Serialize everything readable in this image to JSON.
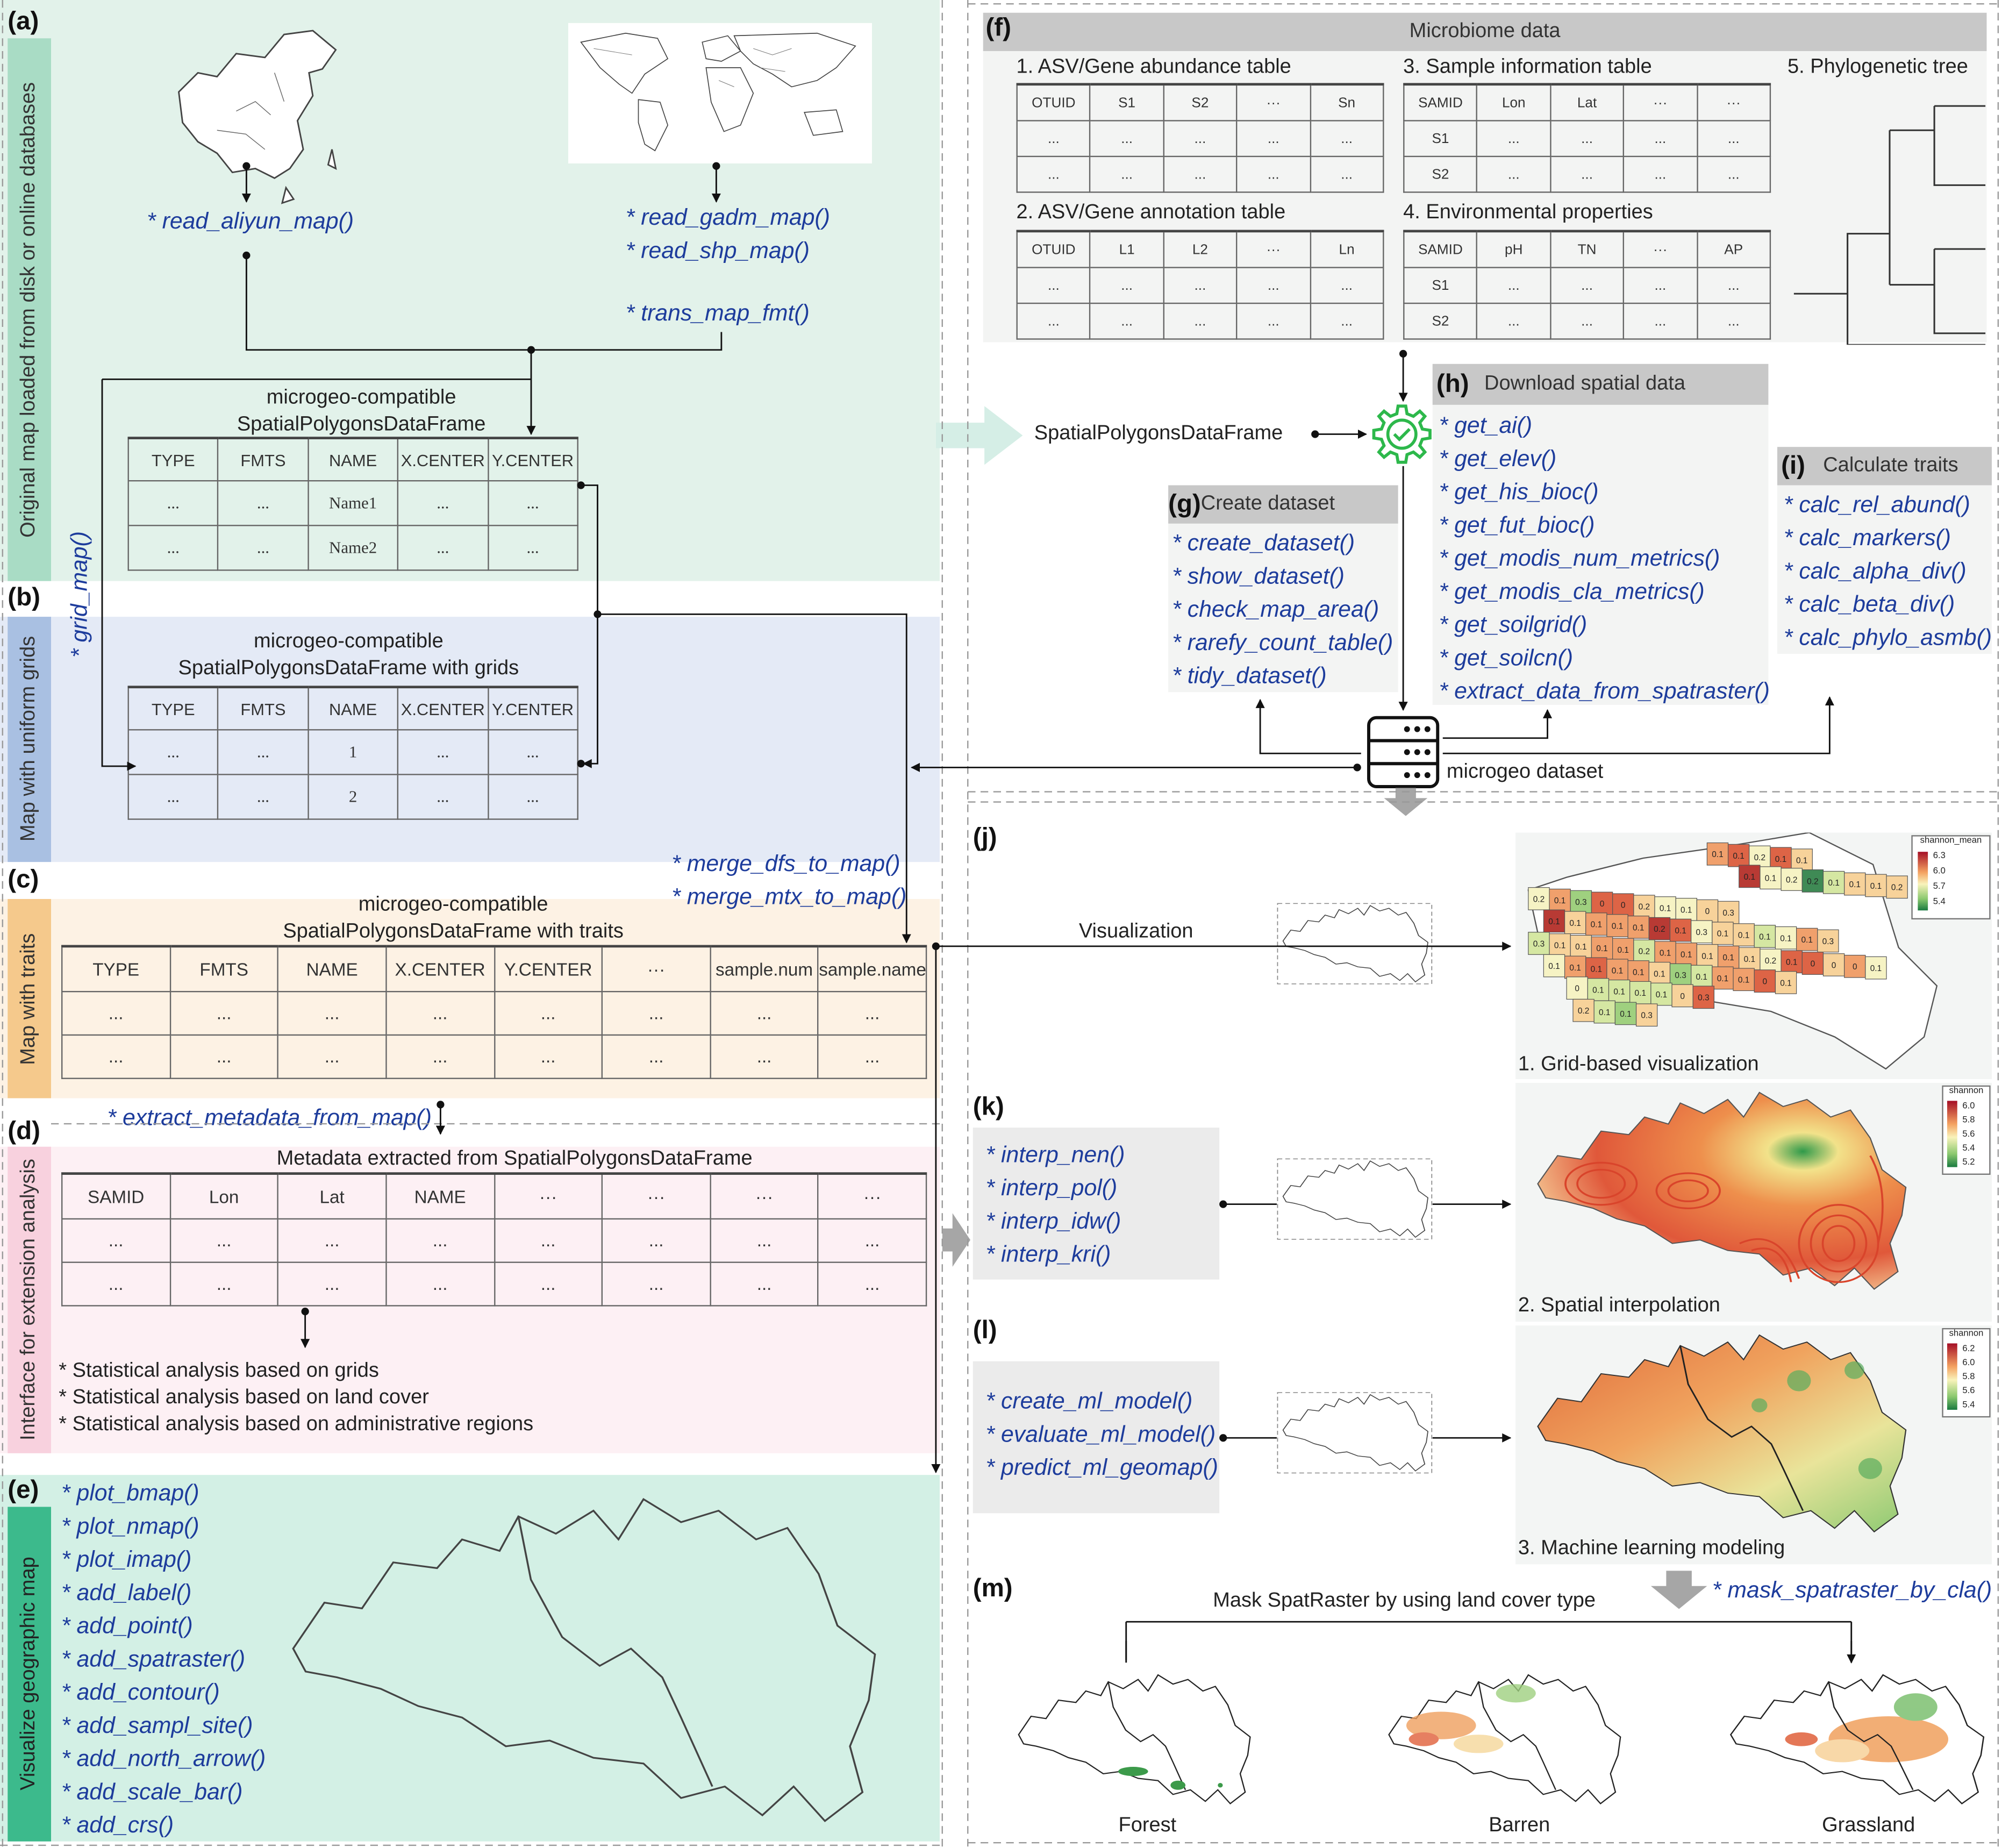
{
  "panels": {
    "a": {
      "label": "(a)",
      "strip": "Original map loaded from disk or online databases",
      "aliyun": "* read_aliyun_map()",
      "gadm_fns": [
        "* read_gadm_map()",
        "* read_shp_map()"
      ],
      "trans": "* trans_map_fmt()",
      "table_title": "microgeo-compatible\nSpatialPolygonsDataFrame",
      "table": {
        "rows": [
          [
            "TYPE",
            "FMTS",
            "NAME",
            "X.CENTER",
            "Y.CENTER"
          ],
          [
            "...",
            "...",
            "Name1",
            "...",
            "..."
          ],
          [
            "...",
            "...",
            "Name2",
            "...",
            "..."
          ]
        ]
      }
    },
    "b": {
      "label": "(b)",
      "strip": "Map with uniform grids",
      "grid_fn": "* grid_map()",
      "table_title": "microgeo-compatible\nSpatialPolygonsDataFrame with grids",
      "table": {
        "rows": [
          [
            "TYPE",
            "FMTS",
            "NAME",
            "X.CENTER",
            "Y.CENTER"
          ],
          [
            "...",
            "...",
            "1",
            "...",
            "..."
          ],
          [
            "...",
            "...",
            "2",
            "...",
            "..."
          ]
        ]
      },
      "merge_fns": [
        "* merge_dfs_to_map()",
        "* merge_mtx_to_map()"
      ]
    },
    "c": {
      "label": "(c)",
      "strip": "Map with traits",
      "table_title": "microgeo-compatible\nSpatialPolygonsDataFrame with traits",
      "table": {
        "rows": [
          [
            "TYPE",
            "FMTS",
            "NAME",
            "X.CENTER",
            "Y.CENTER",
            "···",
            "sample.num",
            "sample.names"
          ],
          [
            "...",
            "...",
            "...",
            "...",
            "...",
            "...",
            "...",
            "..."
          ],
          [
            "...",
            "...",
            "...",
            "...",
            "...",
            "...",
            "...",
            "..."
          ]
        ]
      },
      "extract_fn": "* extract_metadata_from_map()"
    },
    "d": {
      "label": "(d)",
      "strip": "Interface for extension analysis",
      "table_title": "Metadata extracted from SpatialPolygonsDataFrame",
      "table": {
        "rows": [
          [
            "SAMID",
            "Lon",
            "Lat",
            "NAME",
            "···",
            "···",
            "···",
            "···"
          ],
          [
            "...",
            "...",
            "...",
            "...",
            "...",
            "...",
            "...",
            "..."
          ],
          [
            "...",
            "...",
            "...",
            "...",
            "...",
            "...",
            "...",
            "..."
          ]
        ]
      },
      "analyses": [
        "* Statistical analysis based on grids",
        "* Statistical analysis based on land cover",
        "* Statistical analysis based on administrative regions"
      ]
    },
    "e": {
      "label": "(e)",
      "strip": "Visualize geographic map",
      "fns": [
        "* plot_bmap()",
        "* plot_nmap()",
        "* plot_imap()",
        "* add_label()",
        "* add_point()",
        "* add_spatraster()",
        "* add_contour()",
        "* add_sampl_site()",
        "* add_north_arrow()",
        "* add_scale_bar()",
        "* add_crs()"
      ]
    },
    "f": {
      "label": "(f)",
      "title": "Microbiome data",
      "t1_title": "1. ASV/Gene abundance table",
      "t1": {
        "rows": [
          [
            "OTUID",
            "S1",
            "S2",
            "···",
            "Sn"
          ],
          [
            "...",
            "...",
            "...",
            "...",
            "..."
          ],
          [
            "...",
            "...",
            "...",
            "...",
            "..."
          ]
        ]
      },
      "t2_title": "2. ASV/Gene annotation table",
      "t2": {
        "rows": [
          [
            "OTUID",
            "L1",
            "L2",
            "···",
            "Ln"
          ],
          [
            "...",
            "...",
            "...",
            "...",
            "..."
          ],
          [
            "...",
            "...",
            "...",
            "...",
            "..."
          ]
        ]
      },
      "t3_title": "3. Sample information table",
      "t3": {
        "rows": [
          [
            "SAMID",
            "Lon",
            "Lat",
            "···",
            "···"
          ],
          [
            "S1",
            "...",
            "...",
            "...",
            "..."
          ],
          [
            "S2",
            "...",
            "...",
            "...",
            "..."
          ]
        ]
      },
      "t4_title": "4. Environmental properties",
      "t4": {
        "rows": [
          [
            "SAMID",
            "pH",
            "TN",
            "···",
            "AP"
          ],
          [
            "S1",
            "...",
            "...",
            "...",
            "..."
          ],
          [
            "S2",
            "...",
            "...",
            "...",
            "..."
          ]
        ]
      },
      "t5_title": "5. Phylogenetic tree"
    },
    "spdf_label": "SpatialPolygonsDataFrame",
    "g": {
      "label": "(g)",
      "title": "Create dataset",
      "fns": [
        "* create_dataset()",
        "* show_dataset()",
        "* check_map_area()",
        "* rarefy_count_table()",
        "* tidy_dataset()"
      ]
    },
    "h": {
      "label": "(h)",
      "title": "Download spatial data",
      "fns": [
        "* get_ai()",
        "* get_elev()",
        "* get_his_bioc()",
        "* get_fut_bioc()",
        "* get_modis_num_metrics()",
        "* get_modis_cla_metrics()",
        "* get_soilgrid()",
        "* get_soilcn()",
        "* extract_data_from_spatraster()"
      ]
    },
    "i": {
      "label": "(i)",
      "title": "Calculate traits",
      "fns": [
        "* calc_rel_abund()",
        "* calc_markers()",
        "* calc_alpha_div()",
        "* calc_beta_div()",
        "* calc_phylo_asmb()"
      ]
    },
    "dataset_label": "microgeo dataset",
    "j": {
      "label": "(j)",
      "arrow_label": "Visualization",
      "caption": "1. Grid-based visualization"
    },
    "k": {
      "label": "(k)",
      "fns": [
        "* interp_nen()",
        "* interp_pol()",
        "* interp_idw()",
        "* interp_kri()"
      ],
      "caption": "2. Spatial interpolation"
    },
    "l": {
      "label": "(l)",
      "fns": [
        "* create_ml_model()",
        "* evaluate_ml_model()",
        "* predict_ml_geomap()"
      ],
      "caption": "3. Machine learning modeling"
    },
    "m": {
      "label": "(m)",
      "fn": "* mask_spatraster_by_cla()",
      "title": "Mask SpatRaster by using land cover type",
      "types": [
        "Forest",
        "Barren",
        "Grassland"
      ]
    }
  },
  "colors": {
    "function_text": "#1d3c9c",
    "gear": "#2db84b",
    "panel_a": "#e2f2ea",
    "panel_b": "#e4eaf6",
    "panel_c": "#fdf2e4",
    "panel_d": "#fdf0f4",
    "panel_e": "#d3f0e5"
  },
  "chart_data": [
    {
      "type": "heatmap",
      "title": "",
      "legend_title": "shannon_mean",
      "legend_ticks": [
        "6.3",
        "6.0",
        "5.7",
        "5.4"
      ],
      "palette": {
        "DR": "#b83a34",
        "R": "#dd6446",
        "O": "#f0a06c",
        "LO": "#f7d29a",
        "Y": "#f6f3c4",
        "LG": "#d5e7a2",
        "G": "#9fd07f",
        "DG": "#3f8a55"
      },
      "rows": [
        [
          [
            "0.1",
            "O"
          ],
          [
            "0.1",
            "R"
          ],
          [
            "0.2",
            "Y"
          ],
          [
            "0.1",
            "R"
          ],
          [
            "0.1",
            "LO"
          ]
        ],
        [
          [
            "0.1",
            "DR"
          ],
          [
            "0.1",
            "Y"
          ],
          [
            "0.2",
            "Y"
          ],
          [
            "0.2",
            "DG"
          ],
          [
            "0.1",
            "LG"
          ],
          [
            "0.1",
            "LO"
          ],
          [
            "0.1",
            "LO"
          ],
          [
            "0.2",
            "LO"
          ]
        ],
        [
          [
            "0.2",
            "Y"
          ],
          [
            "0.1",
            "O"
          ],
          [
            "0.3",
            "G"
          ],
          [
            "0",
            "R"
          ],
          [
            "0",
            "R"
          ],
          [
            "0.2",
            "LO"
          ],
          [
            "0.1",
            "Y"
          ],
          [
            "0.1",
            "Y"
          ],
          [
            "0",
            "LO"
          ],
          [
            "0.3",
            "LO"
          ]
        ],
        [
          [
            "0.1",
            "DR"
          ],
          [
            "0.1",
            "LO"
          ],
          [
            "0.1",
            "O"
          ],
          [
            "0.1",
            "O"
          ],
          [
            "0.1",
            "O"
          ],
          [
            "0.2",
            "DR"
          ],
          [
            "0.1",
            "R"
          ],
          [
            "0.3",
            "Y"
          ],
          [
            "0.1",
            "LO"
          ],
          [
            "0.1",
            "LO"
          ],
          [
            "0.1",
            "LG"
          ],
          [
            "0.1",
            "Y"
          ],
          [
            "0.1",
            "O"
          ],
          [
            "0.3",
            "LO"
          ]
        ],
        [
          [
            "0.3",
            "LG"
          ],
          [
            "0.1",
            "LO"
          ],
          [
            "0.1",
            "LO"
          ],
          [
            "0.1",
            "O"
          ],
          [
            "0.1",
            "O"
          ],
          [
            "0.2",
            "LG"
          ],
          [
            "0.1",
            "O"
          ],
          [
            "0.1",
            "O"
          ],
          [
            "0.1",
            "LO"
          ],
          [
            "0.1",
            "O"
          ],
          [
            "0.1",
            "LO"
          ],
          [
            "0.2",
            "Y"
          ],
          [
            "0.1",
            "R"
          ],
          [
            "0",
            "R"
          ],
          [
            "0",
            "LO"
          ],
          [
            "0",
            "O"
          ],
          [
            "0.1",
            "Y"
          ]
        ],
        [
          [
            "0.1",
            "Y"
          ],
          [
            "0.1",
            "O"
          ],
          [
            "0.1",
            "R"
          ],
          [
            "0.1",
            "O"
          ],
          [
            "0.1",
            "O"
          ],
          [
            "0.1",
            "LO"
          ],
          [
            "0.3",
            "G"
          ],
          [
            "0.1",
            "LG"
          ],
          [
            "0.1",
            "O"
          ],
          [
            "0.1",
            "O"
          ],
          [
            "0",
            "R"
          ],
          [
            "0.1",
            "LO"
          ]
        ],
        [
          [
            "0",
            "Y"
          ],
          [
            "0.1",
            "LG"
          ],
          [
            "0.1",
            "LG"
          ],
          [
            "0.1",
            "LG"
          ],
          [
            "0.1",
            "LG"
          ],
          [
            "0",
            "LO"
          ],
          [
            "0.3",
            "R"
          ]
        ],
        [
          [
            "0.2",
            "LO"
          ],
          [
            "0.1",
            "LG"
          ],
          [
            "0.1",
            "G"
          ],
          [
            "0.3",
            "LO"
          ]
        ]
      ]
    },
    {
      "type": "heatmap",
      "title": "",
      "legend_title": "shannon",
      "legend_ticks": [
        "6.0",
        "5.8",
        "5.6",
        "5.4",
        "5.2"
      ]
    },
    {
      "type": "heatmap",
      "title": "",
      "legend_title": "shannon",
      "legend_ticks": [
        "6.2",
        "6.0",
        "5.8",
        "5.6",
        "5.4"
      ]
    }
  ]
}
